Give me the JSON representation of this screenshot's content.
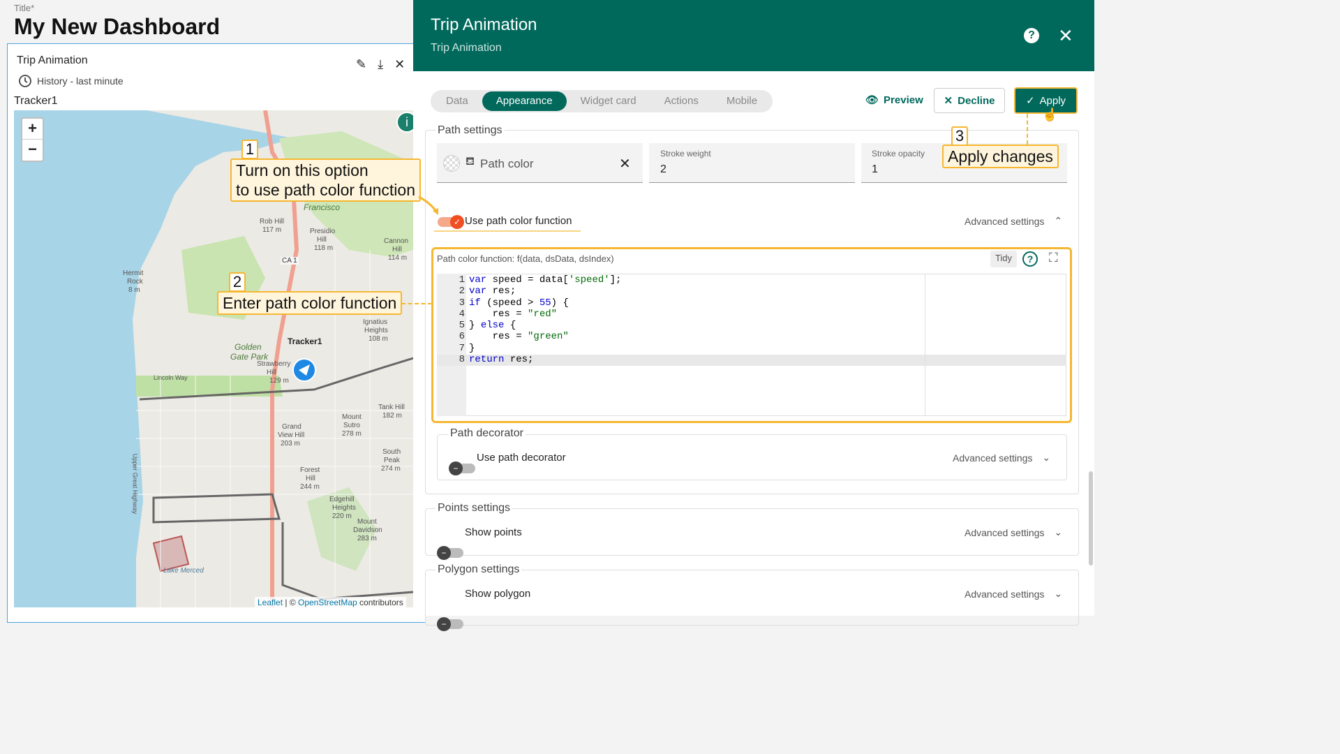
{
  "dashboard": {
    "title_label": "Title*",
    "title": "My New Dashboard"
  },
  "widget": {
    "title": "Trip Animation",
    "history": "History - last minute",
    "tracker_label": "Tracker1",
    "map": {
      "zoom_in": "+",
      "zoom_out": "−",
      "marker_label": "Tracker1",
      "places": [
        "Francisco",
        "Rob Hill",
        "117 m",
        "Presidio",
        "Hill",
        "118 m",
        "Cannon",
        "Hill",
        "114 m",
        "Hermit",
        "Rock",
        "8 m",
        "CA 1",
        "Ignatius",
        "Heights",
        "108 m",
        "Golden",
        "Gate Park",
        "Strawberry",
        "Hill",
        "129 m",
        "Lincoln Way",
        "Tank Hill",
        "182 m",
        "Grand",
        "View Hill",
        "203 m",
        "Mount",
        "Sutro",
        "278 m",
        "South",
        "Peak",
        "274 m",
        "Forest",
        "Hill",
        "244 m",
        "Edgehill",
        "Heights",
        "220 m",
        "Mount",
        "Davidson",
        "283 m",
        "Upper Great Highway",
        "Lake Merced"
      ],
      "attribution": {
        "leaflet": "Leaflet",
        "sep": " | © ",
        "osm": "OpenStreetMap",
        "tail": " contributors"
      }
    }
  },
  "callouts": {
    "c1_num": "1",
    "c1_line1": "Turn on this option",
    "c1_line2": "to use path color function",
    "c2_num": "2",
    "c2_text": "Enter path color function",
    "c3_num": "3",
    "c3_text": "Apply changes"
  },
  "panel": {
    "title": "Trip Animation",
    "subtitle": "Trip Animation",
    "tabs": [
      "Data",
      "Appearance",
      "Widget card",
      "Actions",
      "Mobile"
    ],
    "active_tab": "Appearance",
    "preview": "Preview",
    "decline": "Decline",
    "apply": "Apply",
    "path_settings": {
      "legend": "Path settings",
      "path_color": "Path color",
      "stroke_weight_label": "Stroke weight",
      "stroke_weight": "2",
      "stroke_opacity_label": "Stroke opacity",
      "stroke_opacity": "1",
      "use_fn_label": "Use path color function",
      "use_fn_on": true,
      "advanced": "Advanced settings",
      "fn_label": "Path color function: f(data, dsData, dsIndex)",
      "tidy": "Tidy",
      "code": [
        "var speed = data['speed'];",
        "var res;",
        "if (speed > 55) {",
        "    res = \"red\"",
        "} else {",
        "    res = \"green\"",
        "}",
        "return res;"
      ],
      "line_numbers": [
        "1",
        "2",
        "3",
        "4",
        "5",
        "6",
        "7",
        "8"
      ]
    },
    "path_decorator": {
      "legend": "Path decorator",
      "toggle_label": "Use path decorator",
      "advanced": "Advanced settings"
    },
    "points": {
      "legend": "Points settings",
      "toggle_label": "Show points",
      "advanced": "Advanced settings"
    },
    "polygon": {
      "legend": "Polygon settings",
      "toggle_label": "Show polygon",
      "advanced": "Advanced settings"
    }
  },
  "colors": {
    "primary": "#00695c",
    "accent": "#f5b731",
    "toggle_on": "#f04e23"
  }
}
